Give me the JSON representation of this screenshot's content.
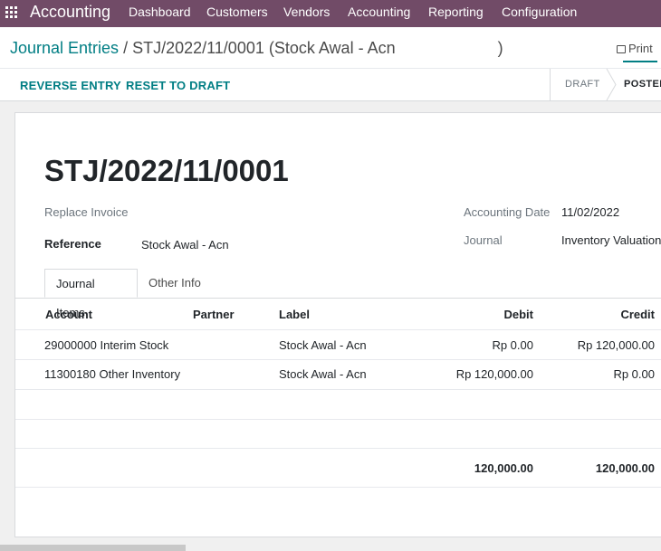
{
  "topbar": {
    "app_name": "Accounting",
    "menu": [
      "Dashboard",
      "Customers",
      "Vendors",
      "Accounting",
      "Reporting",
      "Configuration"
    ]
  },
  "breadcrumb": {
    "parent": "Journal Entries",
    "separator": "/",
    "current": "STJ/2022/11/0001 (Stock Awal - Acn",
    "current_end": ")"
  },
  "actions": {
    "print": "Print",
    "reverse_entry": "REVERSE ENTRY",
    "reset_to_draft": "RESET TO DRAFT"
  },
  "statusbar": {
    "draft": "DRAFT",
    "posted": "POSTEI"
  },
  "form": {
    "title": "STJ/2022/11/0001",
    "replace_invoice": "Replace Invoice",
    "reference_label": "Reference",
    "reference_value": "Stock Awal - Acn",
    "accounting_date_label": "Accounting Date",
    "accounting_date_value": "11/02/2022",
    "journal_label": "Journal",
    "journal_value": "Inventory Valuation"
  },
  "tabs": [
    "Journal Items",
    "Other Info"
  ],
  "table": {
    "headers": {
      "account": "Account",
      "partner": "Partner",
      "label": "Label",
      "debit": "Debit",
      "credit": "Credit"
    },
    "rows": [
      {
        "account": "29000000 Interim Stock",
        "partner": "",
        "label": "Stock Awal - Acn",
        "debit": "Rp 0.00",
        "credit": "Rp 120,000.00"
      },
      {
        "account": "11300180 Other Inventory",
        "partner": "",
        "label": "Stock Awal - Acn",
        "debit": "Rp 120,000.00",
        "credit": "Rp 0.00"
      }
    ],
    "totals": {
      "debit": "120,000.00",
      "credit": "120,000.00"
    }
  },
  "colors": {
    "brand": "#714b67",
    "link": "#017e84"
  }
}
